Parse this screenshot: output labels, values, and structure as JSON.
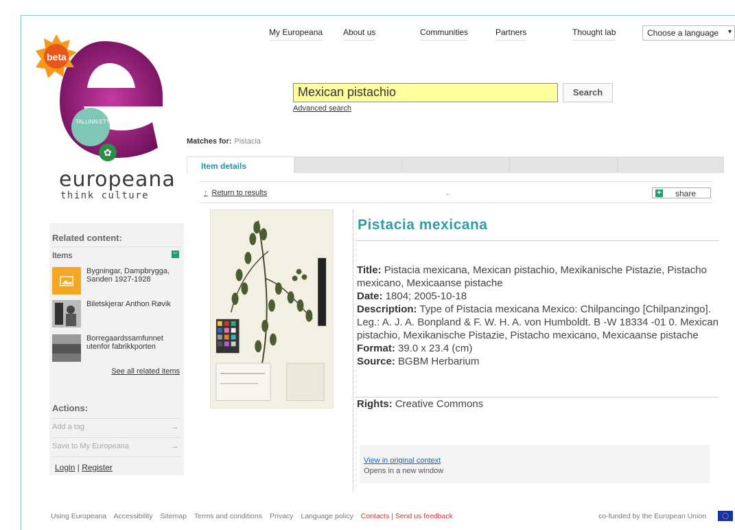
{
  "header": {
    "badge": "beta",
    "brand_name": "europeana",
    "brand_tagline": "think culture",
    "logo_stamp": "TALLINN ETTUSTA VAROCK",
    "nav": [
      "My Europeana",
      "About us",
      "Communities",
      "Partners",
      "Thought lab"
    ],
    "language_select": "Choose a language"
  },
  "search": {
    "value": "Mexican pistachio",
    "button": "Search",
    "advanced": "Advanced search"
  },
  "matches": {
    "label": "Matches for:",
    "term": "Pistacia"
  },
  "tabs": [
    "Item details",
    "",
    "",
    "",
    ""
  ],
  "result_bar": {
    "return": "Return to results",
    "share": "share"
  },
  "item": {
    "title": "Pistacia mexicana",
    "fields": {
      "title_label": "Title:",
      "title_value": "Pistacia mexicana, Mexican pistachio, Mexikanische Pistazie, Pistacho mexicano, Mexicaanse pistache",
      "date_label": "Date:",
      "date_value": "1804; 2005-10-18",
      "description_label": "Description:",
      "description_value": "Type of Pistacia mexicana Mexico: Chilpancingo [Chilpanzingo].",
      "description_extra": "Leg.: A. J. A. Bonpland & F. W. H. A. von Humboldt. B -W 18334 -01 0. Mexican pistachio, Mexikanische Pistazie, Pistacho mexicano, Mexicaanse pistache",
      "format_label": "Format:",
      "format_value": "39.0 x 23.4 (cm)",
      "source_label": "Source:",
      "source_value": "BGBM Herbarium",
      "rights_label": "Rights:",
      "rights_value": "Creative Commons"
    },
    "original_link": "View in original context",
    "original_note": "Opens in a new window"
  },
  "sidebar": {
    "related_heading": "Related content:",
    "items_heading": "Items",
    "items_toggle": "−",
    "related_items": [
      {
        "label": "Bygningar, Dampbrygga, Sanden 1927-1928"
      },
      {
        "label": "Biletskjerar Anthon Røvik"
      },
      {
        "label": "Borregaardssamfunnet utenfor fabrikkporten"
      }
    ],
    "see_all": "See all related items",
    "actions_heading": "Actions:",
    "actions": [
      "Add a tag",
      "Save to My Europeana"
    ],
    "login": "Login",
    "separator": "|",
    "register": "Register"
  },
  "footer": {
    "links": [
      "Using Europeana",
      "Accessibility",
      "Sitemap",
      "Terms and conditions",
      "Privacy",
      "Language policy"
    ],
    "contacts": "Contacts | Send us feedback",
    "cofunded": "co-funded by the European Union"
  },
  "colors": {
    "accent": "#2b9fa5",
    "search_bg": "#ffffa0",
    "logo_magenta": "#9c1a7a",
    "green_button": "#1aa16a"
  }
}
